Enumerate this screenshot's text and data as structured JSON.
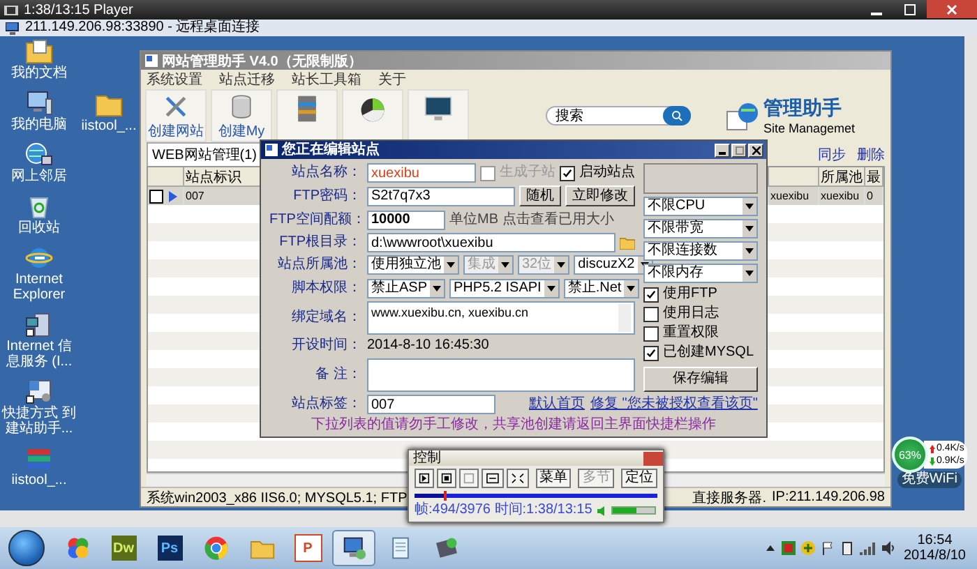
{
  "player": {
    "title": "1:38/13:15 Player"
  },
  "remote_desktop": {
    "title": "211.149.206.98:33890 - 远程桌面连接"
  },
  "desktop": {
    "icons": [
      {
        "label": "我的文档",
        "kind": "folder-doc"
      },
      {
        "label": "我的电脑",
        "kind": "computer"
      },
      {
        "label": "网上邻居",
        "kind": "network"
      },
      {
        "label": "回收站",
        "kind": "recycle"
      },
      {
        "label": "Internet Explorer",
        "kind": "browser"
      },
      {
        "label": "Internet 信息服务 (I...",
        "kind": "server"
      },
      {
        "label": "快捷方式 到建站助手...",
        "kind": "shortcut"
      },
      {
        "label": "iistool_...",
        "kind": "archive"
      }
    ],
    "second_column_icons": [
      {
        "label": "iistool_...",
        "kind": "folder"
      }
    ]
  },
  "app_window": {
    "title": "网站管理助手 V4.0（无限制版）",
    "menu": [
      "系统设置",
      "站点迁移",
      "站长工具箱",
      "关于"
    ],
    "toolbar": [
      {
        "kind": "tools",
        "label": "创建网站"
      },
      {
        "kind": "database",
        "label": "创建My"
      },
      {
        "kind": "server"
      },
      {
        "kind": "pie"
      },
      {
        "kind": "monitor"
      }
    ],
    "search": {
      "placeholder": "搜索"
    },
    "logo": {
      "title": "管理助手",
      "subtitle": "Site Managemet"
    },
    "tabs": [
      {
        "label": "WEB网站管理(1)",
        "selected": true
      }
    ],
    "actions": [
      "同步",
      "删除"
    ],
    "table": {
      "columns": {
        "column_2": "站点标识",
        "column_5": "所属池",
        "column_6": "最"
      },
      "rows": [
        {
          "checked": false,
          "selected": true,
          "column_2": "007",
          "column_4": "xuexibu",
          "column_5": "xuexibu",
          "column_6": "0"
        }
      ]
    },
    "status_bar": [
      "系统win2003_x86 IIS6.0; MYSQL5.1; FTP",
      "直接服务器.",
      "IP:211.149.206.98"
    ]
  },
  "dialog": {
    "title": "您正在编辑站点",
    "name": {
      "label": "站点名称：",
      "value": "xuexibu"
    },
    "name_options": [
      {
        "label": "生成子站",
        "checked": false,
        "disabled": true
      },
      {
        "label": "启动站点",
        "checked": true,
        "disabled": false
      }
    ],
    "ftp_password": {
      "label": "FTP密码：",
      "value": "S2t7q7x3"
    },
    "password_buttons": [
      "随机",
      "立即修改"
    ],
    "quota": {
      "label": "FTP空间配额：",
      "value": "10000",
      "note": "单位MB 点击查看已用大小"
    },
    "ftp_root": {
      "label": "FTP根目录：",
      "value": "d:\\wwwroot\\xuexibu"
    },
    "pool": {
      "label": "站点所属池：",
      "selects": [
        {
          "value": "使用独立池",
          "disabled": false
        },
        {
          "value": "集成",
          "disabled": true
        },
        {
          "value": "32位",
          "disabled": true
        },
        {
          "value": "discuzX2",
          "disabled": false
        }
      ]
    },
    "script": {
      "label": "脚本权限：",
      "selects": [
        {
          "value": "禁止ASP",
          "disabled": false
        },
        {
          "value": "PHP5.2 ISAPI",
          "disabled": false
        },
        {
          "value": "禁止.Net",
          "disabled": false
        }
      ]
    },
    "domains": {
      "label": "绑定域名：",
      "value": "www.xuexibu.cn, xuexibu.cn"
    },
    "created": {
      "label": "开设时间：",
      "value": "2014-8-10 16:45:30"
    },
    "remark": {
      "label": "备 注："
    },
    "tag": {
      "label": "站点标签：",
      "value": "007"
    },
    "links": [
      "默认首页",
      "修复 \"您未被授权查看该页\""
    ],
    "limits": [
      "不限CPU",
      "不限带宽",
      "不限连接数",
      "不限内存"
    ],
    "options": [
      {
        "label": "使用FTP",
        "checked": true
      },
      {
        "label": "使用日志",
        "checked": false
      },
      {
        "label": "重置权限",
        "checked": false
      },
      {
        "label": "已创建MYSQL",
        "checked": true
      }
    ],
    "save_button": "保存编辑",
    "footer_note": "下拉列表的值请勿手工修改，共享池创建请返回主界面快捷栏操作"
  },
  "control": {
    "title": "控制",
    "buttons": [
      {
        "kind": "step",
        "disabled": false
      },
      {
        "kind": "stop",
        "disabled": false
      },
      {
        "kind": "blank",
        "disabled": true
      },
      {
        "kind": "fit",
        "disabled": false
      },
      {
        "kind": "full",
        "disabled": false
      },
      {
        "kind": "text",
        "label": "菜单",
        "disabled": false
      },
      {
        "kind": "text",
        "label": "多节",
        "disabled": true
      },
      {
        "kind": "text",
        "label": "定位",
        "disabled": false
      }
    ],
    "progress": {
      "level": 0.124
    },
    "status": "帧:494/3976 时间:1:38/13:15",
    "volume": {
      "level": 0.55
    }
  },
  "network_widget": {
    "percent": "63%",
    "upload": "0.4K/s",
    "download": "0.9K/s",
    "label": "免费WiFi"
  },
  "taskbar": {
    "apps": [
      {
        "kind": "start",
        "selected": false
      },
      {
        "kind": "pinwheel",
        "selected": false
      },
      {
        "kind": "dw",
        "label": "Dw",
        "selected": false
      },
      {
        "kind": "ps",
        "label": "Ps",
        "selected": false
      },
      {
        "kind": "browser",
        "selected": false
      },
      {
        "kind": "files",
        "selected": false
      },
      {
        "kind": "slides",
        "label": "P",
        "selected": false
      },
      {
        "kind": "remote",
        "selected": true
      },
      {
        "kind": "notepad",
        "selected": false
      },
      {
        "kind": "tool",
        "selected": false
      }
    ],
    "time": "16:54",
    "date": "2014/8/10"
  }
}
